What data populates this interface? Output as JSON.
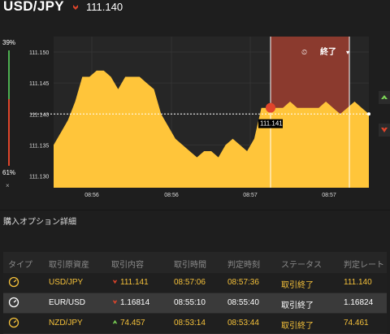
{
  "header": {
    "pair": "USD/JPY",
    "price": "111.140",
    "direction": "down"
  },
  "sidebar": {
    "up_percent": "39%",
    "down_percent": "61%",
    "close_glyph": "×"
  },
  "chart_data": {
    "type": "area",
    "title": "",
    "y_ticks": [
      "111.150",
      "111.145",
      "111.140",
      "111.135",
      "111.130"
    ],
    "x_ticks": [
      "08:56",
      "08:56",
      "08:57",
      "08:57"
    ],
    "ylim": [
      111.1281,
      111.1525
    ],
    "current_rate": "111.140",
    "entry_marker": {
      "label": "111.141",
      "value": 111.141
    },
    "expiry_zone": {
      "label": "終了"
    },
    "area_color": "#ffc53a",
    "zone_color": "#8b3a2e",
    "y": [
      111.135,
      111.137,
      111.139,
      111.142,
      111.146,
      111.146,
      111.147,
      111.147,
      111.146,
      111.144,
      111.146,
      111.146,
      111.146,
      111.145,
      111.144,
      111.14,
      111.138,
      111.136,
      111.135,
      111.134,
      111.133,
      111.134,
      111.134,
      111.133,
      111.135,
      111.136,
      111.135,
      111.134,
      111.136,
      111.141,
      111.141,
      111.141,
      111.141,
      111.142,
      111.141,
      111.141,
      111.141,
      111.141,
      111.142,
      111.141,
      111.14,
      111.141,
      111.142,
      111.141,
      111.14
    ]
  },
  "details": {
    "title": "購入オプション詳細",
    "columns": [
      "タイプ",
      "取引原資産",
      "取引内容",
      "取引時間",
      "判定時刻",
      "ステータス",
      "判定レート"
    ],
    "rows": [
      {
        "asset": "USD/JPY",
        "dir": "down",
        "price": "111.141",
        "trade_time": "08:57:06",
        "judge_time": "08:57:36",
        "status": "取引終了",
        "rate": "111.140"
      },
      {
        "asset": "EUR/USD",
        "dir": "down",
        "price": "1.16814",
        "trade_time": "08:55:10",
        "judge_time": "08:55:40",
        "status": "取引終了",
        "rate": "1.16824"
      },
      {
        "asset": "NZD/JPY",
        "dir": "up",
        "price": "74.457",
        "trade_time": "08:53:14",
        "judge_time": "08:53:44",
        "status": "取引終了",
        "rate": "74.461"
      }
    ]
  },
  "colors": {
    "up": "#7ed957",
    "down": "#e0452b",
    "value_yellow": "#f5c13a",
    "white_text": "#ffffff"
  }
}
